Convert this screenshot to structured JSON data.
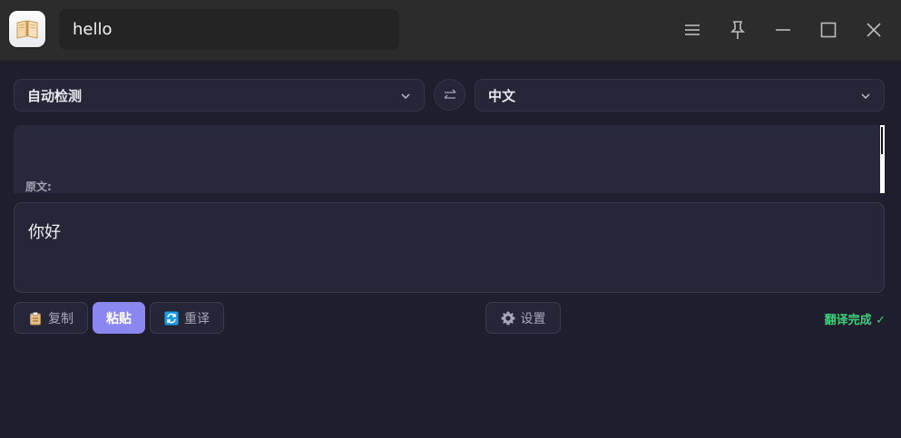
{
  "search": {
    "value": "hello"
  },
  "window_controls": [
    {
      "name": "menu-icon"
    },
    {
      "name": "pin-icon"
    },
    {
      "name": "minimize-icon"
    },
    {
      "name": "maximize-icon"
    },
    {
      "name": "close-icon"
    }
  ],
  "languages": {
    "source": "自动检测",
    "target": "中文",
    "swap_icon": "swap-arrows-icon"
  },
  "source_panel": {
    "label": "原文:"
  },
  "result_panel": {
    "text": "你好"
  },
  "actions": {
    "copy_label": "复制",
    "paste_label": "粘贴",
    "retranslate_label": "重译",
    "settings_label": "设置"
  },
  "status": {
    "text": "翻译完成 ✓"
  },
  "colors": {
    "accent": "#8b87f0",
    "success": "#3fcf7a",
    "background": "#1f1e2e"
  }
}
